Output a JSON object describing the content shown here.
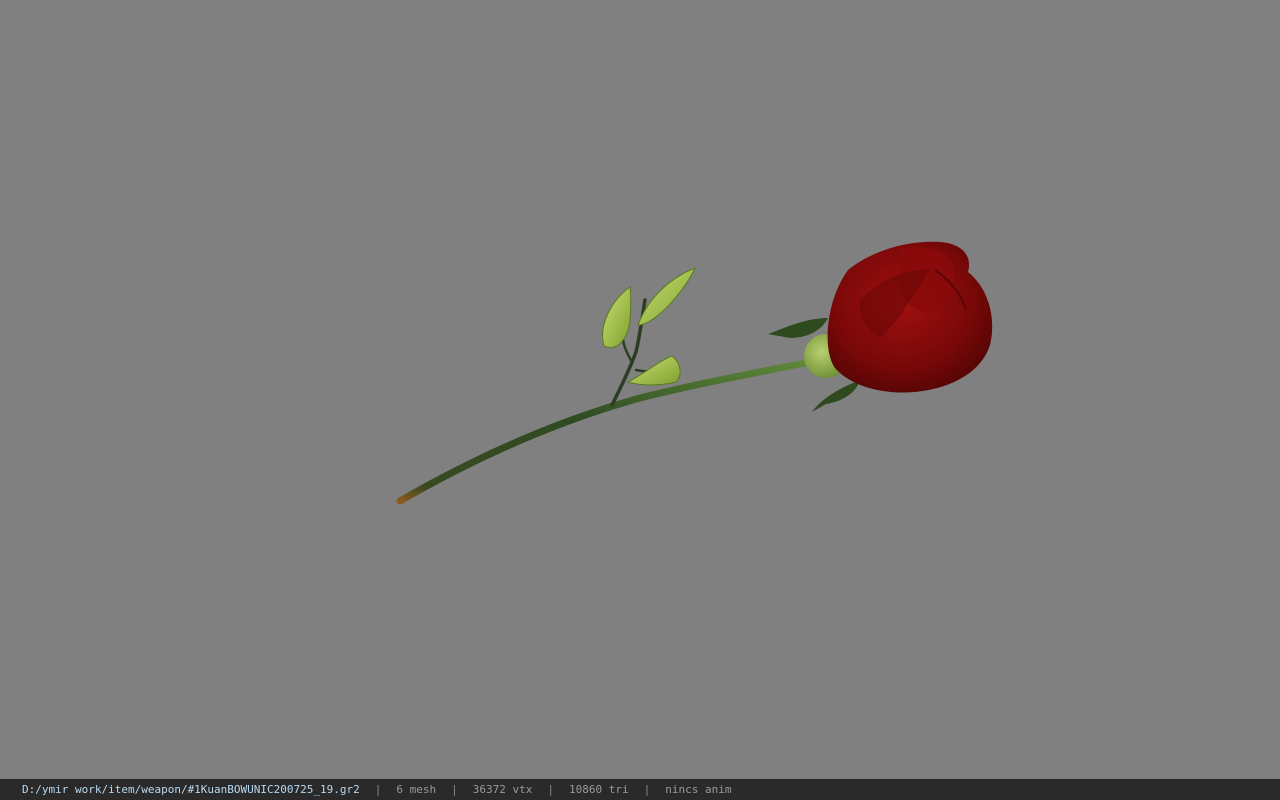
{
  "viewer": {
    "background_color": "#808080",
    "model_name": "rose"
  },
  "status": {
    "file_path": "D:/ymir work/item/weapon/#1KuanBOWUNIC200725_19.gr2",
    "mesh_count": "6 mesh",
    "vertex_count": "36372 vtx",
    "triangle_count": "10860 tri",
    "animation": "nincs anim",
    "separator": "|"
  }
}
